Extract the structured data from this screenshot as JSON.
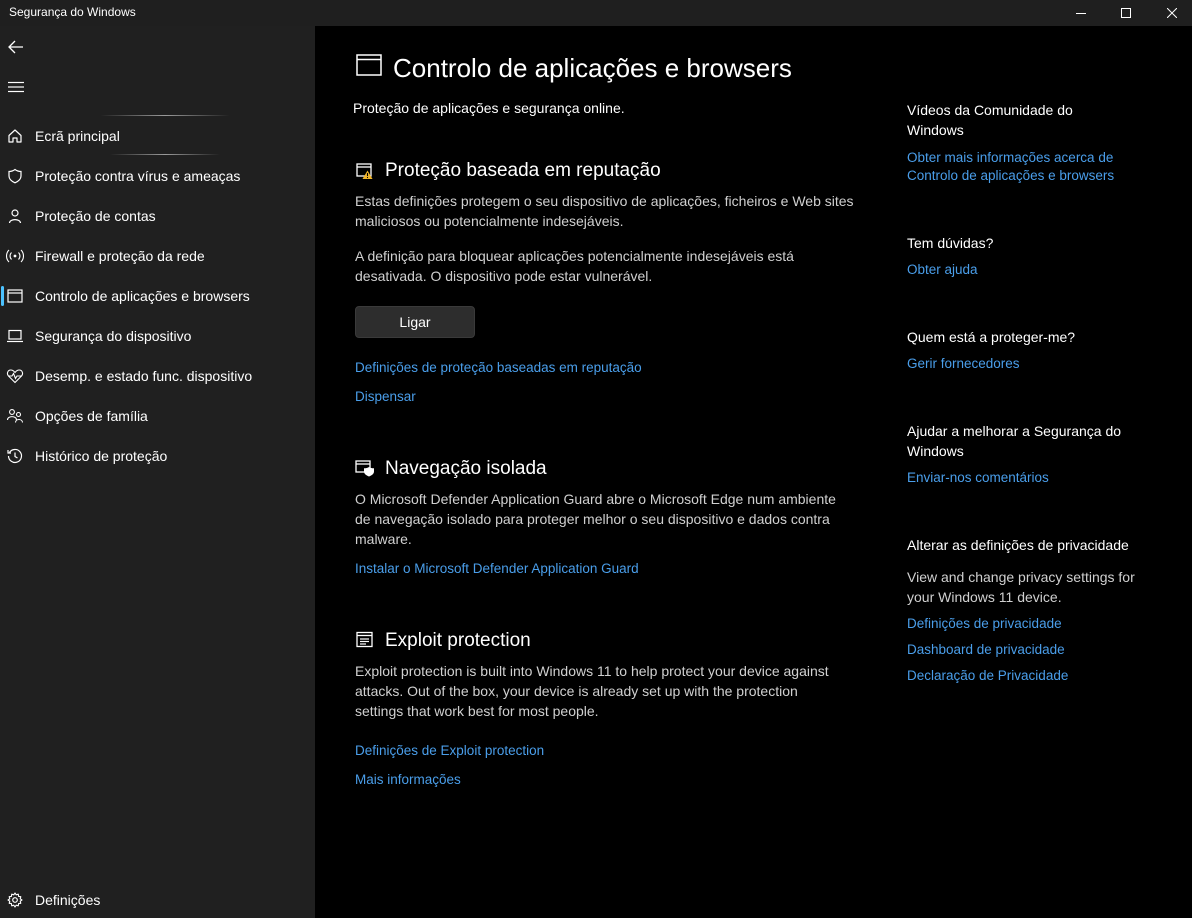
{
  "window": {
    "title": "Segurança do Windows"
  },
  "sidebar": {
    "items": [
      {
        "label": "Ecrã principal",
        "icon": "home-icon"
      },
      {
        "label": "Proteção contra vírus e ameaças",
        "icon": "shield-icon"
      },
      {
        "label": "Proteção de contas",
        "icon": "person-icon"
      },
      {
        "label": "Firewall e proteção da rede",
        "icon": "antenna-icon"
      },
      {
        "label": "Controlo de aplicações e browsers",
        "icon": "app-window-icon",
        "active": true
      },
      {
        "label": "Segurança do dispositivo",
        "icon": "laptop-icon"
      },
      {
        "label": "Desemp. e estado func. dispositivo",
        "icon": "heart-pulse-icon"
      },
      {
        "label": "Opções de família",
        "icon": "family-icon"
      },
      {
        "label": "Histórico de proteção",
        "icon": "history-icon"
      }
    ],
    "settings_label": "Definições",
    "accent_color": "#4cc2ff"
  },
  "main": {
    "title": "Controlo de aplicações e browsers",
    "subtitle": "Proteção de aplicações e segurança online.",
    "reputation": {
      "title": "Proteção baseada em reputação",
      "desc1": "Estas definições protegem o seu dispositivo de aplicações, ficheiros e Web sites maliciosos ou potencialmente indesejáveis.",
      "desc2": "A definição para bloquear aplicações potencialmente indesejáveis está desativada. O dispositivo pode estar vulnerável.",
      "button_label": "Ligar",
      "settings_link": "Definições de proteção baseadas em reputação",
      "dismiss_link": "Dispensar"
    },
    "isolated": {
      "title": "Navegação isolada",
      "desc": "O Microsoft Defender Application Guard abre o Microsoft Edge num ambiente de navegação isolado para proteger melhor o seu dispositivo e dados contra malware.",
      "install_link": "Instalar o Microsoft Defender Application Guard"
    },
    "exploit": {
      "title": "Exploit protection",
      "desc": "Exploit protection is built into Windows 11 to help protect your device against attacks.  Out of the box, your device is already set up with the protection settings that work best for most people.",
      "settings_link": "Definições de Exploit protection",
      "more_link": "Mais informações"
    }
  },
  "right": {
    "community": {
      "heading": "Vídeos da Comunidade do Windows",
      "link": "Obter mais informações acerca de Controlo de aplicações e browsers"
    },
    "questions": {
      "heading": "Tem dúvidas?",
      "link": "Obter ajuda"
    },
    "protecting": {
      "heading": "Quem está a proteger-me?",
      "link": "Gerir fornecedores"
    },
    "improve": {
      "heading": "Ajudar a melhorar a Segurança do Windows",
      "link": "Enviar-nos comentários"
    },
    "privacy": {
      "heading": "Alterar as definições de privacidade",
      "desc": "View and change privacy settings for your Windows 11 device.",
      "links": [
        "Definições de privacidade",
        "Dashboard de privacidade",
        "Declaração de Privacidade"
      ]
    }
  },
  "colors": {
    "link": "#4a9eea",
    "sidebar_bg": "#202020",
    "main_bg": "#000000"
  }
}
